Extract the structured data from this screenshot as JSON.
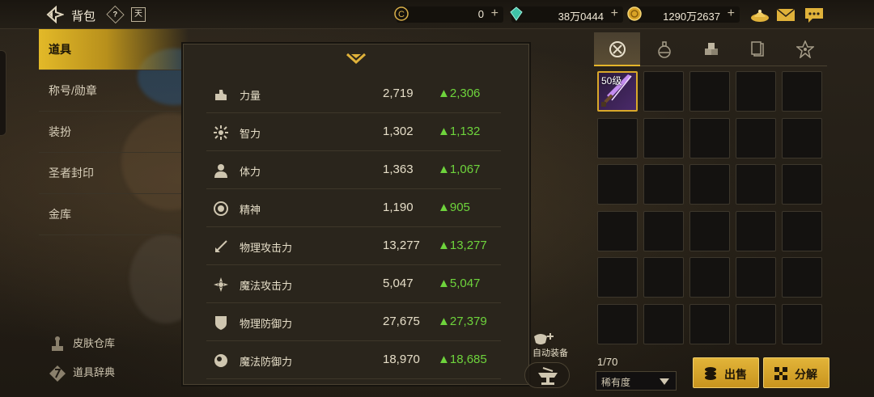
{
  "header": {
    "title": "背包",
    "help_label": "?",
    "calendar_label": "天",
    "currencies": [
      {
        "name": "coin-c",
        "value": "0",
        "plus": "+"
      },
      {
        "name": "gem",
        "value": "38万0444",
        "plus": "+"
      },
      {
        "name": "gold",
        "value": "1290万2637",
        "plus": "+"
      }
    ],
    "icons": [
      "shop-icon",
      "mail-icon",
      "chat-icon"
    ]
  },
  "sidebar": {
    "items": [
      {
        "label": "道具",
        "active": true
      },
      {
        "label": "称号/勋章",
        "active": false
      },
      {
        "label": "装扮",
        "active": false
      },
      {
        "label": "圣者封印",
        "active": false
      },
      {
        "label": "金库",
        "active": false
      }
    ],
    "skin_storage": "皮肤仓库",
    "item_dictionary": "道具辞典"
  },
  "stats": {
    "rows": [
      {
        "name": "力量",
        "value": "2,719",
        "delta": "▲2,306",
        "icon": "strength-icon"
      },
      {
        "name": "智力",
        "value": "1,302",
        "delta": "▲1,132",
        "icon": "intelligence-icon"
      },
      {
        "name": "体力",
        "value": "1,363",
        "delta": "▲1,067",
        "icon": "vitality-icon"
      },
      {
        "name": "精神",
        "value": "1,190",
        "delta": "▲905",
        "icon": "spirit-icon"
      },
      {
        "name": "物理攻击力",
        "value": "13,277",
        "delta": "▲13,277",
        "icon": "physical-attack-icon"
      },
      {
        "name": "魔法攻击力",
        "value": "5,047",
        "delta": "▲5,047",
        "icon": "magic-attack-icon"
      },
      {
        "name": "物理防御力",
        "value": "27,675",
        "delta": "▲27,379",
        "icon": "physical-defense-icon"
      },
      {
        "name": "魔法防御力",
        "value": "18,970",
        "delta": "▲18,685",
        "icon": "magic-defense-icon"
      }
    ]
  },
  "actions": {
    "auto_equip": "自动装备"
  },
  "inventory": {
    "tabs": [
      "equipment-tab-icon",
      "potion-tab-icon",
      "material-tab-icon",
      "card-tab-icon",
      "special-tab-icon"
    ],
    "first_item_level": "50级",
    "capacity": "1/70",
    "rarity_filter": "稀有度",
    "sell_label": "出售",
    "disassemble_label": "分解"
  }
}
